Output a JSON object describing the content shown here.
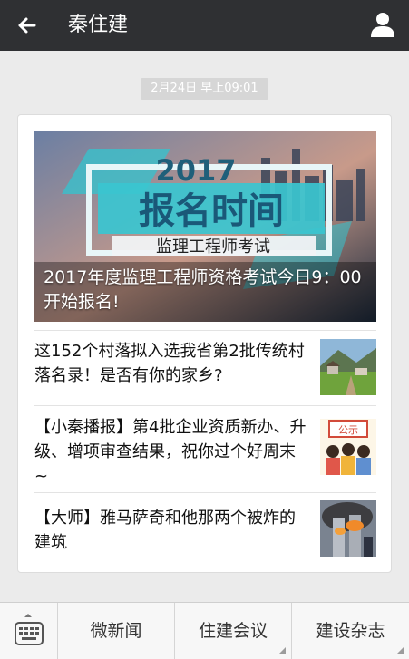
{
  "header": {
    "title": "秦住建"
  },
  "timestamp": "2月24日 早上09:01",
  "article": {
    "hero": {
      "caption": "2017年度监理工程师资格考试今日9：00开始报名!",
      "banner_year": "2017",
      "banner_main": "报名时间",
      "banner_sub": "监理工程师考试"
    },
    "items": [
      {
        "title": "这152个村落拟入选我省第2批传统村落名录！是否有你的家乡?"
      },
      {
        "title": "【小秦播报】第4批企业资质新办、升级、增项审查结果，祝你过个好周末~",
        "thumb_text": "公示"
      },
      {
        "title": "【大师】雅马萨奇和他那两个被炸的建筑"
      }
    ]
  },
  "bottom_menu": {
    "items": [
      "微新闻",
      "住建会议",
      "建设杂志"
    ]
  },
  "colors": {
    "topbar": "#2f3033",
    "background": "#ebebeb",
    "card": "#ffffff",
    "accent_teal": "#33c4cf"
  }
}
